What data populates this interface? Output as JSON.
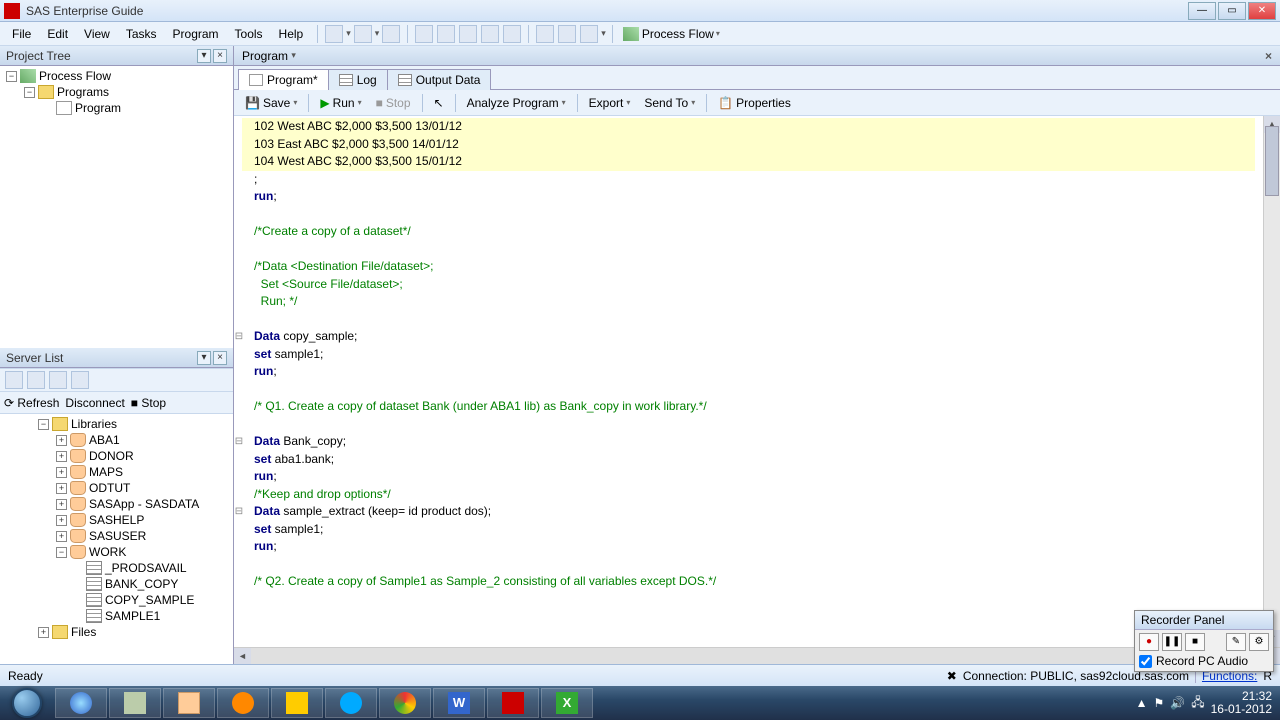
{
  "app_title": "SAS Enterprise Guide",
  "menus": [
    "File",
    "Edit",
    "View",
    "Tasks",
    "Program",
    "Tools",
    "Help"
  ],
  "toolbar_proc_flow": "Process Flow",
  "project_tree": {
    "title": "Project Tree",
    "root": "Process Flow",
    "folder": "Programs",
    "item": "Program"
  },
  "server_list": {
    "title": "Server List",
    "refresh": "Refresh",
    "disconnect": "Disconnect",
    "stop": "Stop",
    "libraries": "Libraries",
    "libs": [
      "ABA1",
      "DONOR",
      "MAPS",
      "ODTUT",
      "SASApp - SASDATA",
      "SASHELP",
      "SASUSER"
    ],
    "work": "WORK",
    "work_items": [
      "_PRODSAVAIL",
      "BANK_COPY",
      "COPY_SAMPLE",
      "SAMPLE1"
    ],
    "files": "Files"
  },
  "doc": {
    "title": "Program",
    "arrow": "▾"
  },
  "tabs": {
    "program": "Program*",
    "log": "Log",
    "output": "Output Data"
  },
  "code_toolbar": {
    "save": "Save",
    "run": "Run",
    "stop": "Stop",
    "analyze": "Analyze Program",
    "export": "Export",
    "sendto": "Send To",
    "properties": "Properties"
  },
  "code_lines": [
    {
      "cls": "hl",
      "t": "102 West ABC $2,000 $3,500 13/01/12"
    },
    {
      "cls": "hl",
      "t": "103 East ABC $2,000 $3,500 14/01/12"
    },
    {
      "cls": "hl",
      "t": "104 West ABC $2,000 $3,500 15/01/12"
    },
    {
      "t": ";"
    },
    {
      "html": "<span class='kw'>run</span>;"
    },
    {
      "t": ""
    },
    {
      "cls": "cm",
      "t": "/*Create a copy of a dataset*/"
    },
    {
      "t": ""
    },
    {
      "cls": "cm",
      "t": "/*Data <Destination File/dataset>;"
    },
    {
      "cls": "cm",
      "t": "  Set <Source File/dataset>;"
    },
    {
      "cls": "cm",
      "t": "  Run; */"
    },
    {
      "t": ""
    },
    {
      "g": "⊟",
      "html": "<span class='kw'>Data</span> copy_sample;"
    },
    {
      "html": "<span class='kw'>set</span> sample1;"
    },
    {
      "html": "<span class='kw'>run</span>;"
    },
    {
      "t": ""
    },
    {
      "cls": "cm",
      "t": "/* Q1. Create a copy of dataset Bank (under ABA1 lib) as Bank_copy in work library.*/"
    },
    {
      "t": ""
    },
    {
      "g": "⊟",
      "html": "<span class='kw'>Data</span> Bank_copy;"
    },
    {
      "html": "<span class='kw'>set</span> aba1.bank;"
    },
    {
      "html": "<span class='kw'>run</span>;"
    },
    {
      "cls": "cm",
      "t": "/*Keep and drop options*/"
    },
    {
      "g": "⊟",
      "html": "<span class='kw'>Data</span> sample_extract (keep= id product dos);"
    },
    {
      "html": "<span class='kw'>set</span> sample1;"
    },
    {
      "html": "<span class='kw'>run</span>;"
    },
    {
      "t": ""
    },
    {
      "cls": "cm",
      "t": "/* Q2. Create a copy of Sample1 as Sample_2 consisting of all variables except DOS.*/"
    }
  ],
  "status": {
    "ready": "Ready",
    "connection": "Connection:  PUBLIC, sas92cloud.sas.com",
    "functions": "Functions:",
    "r": "R"
  },
  "recorder": {
    "title": "Recorder Panel",
    "record_label": "Record PC Audio"
  },
  "clock": {
    "time": "21:32",
    "date": "16-01-2012"
  }
}
